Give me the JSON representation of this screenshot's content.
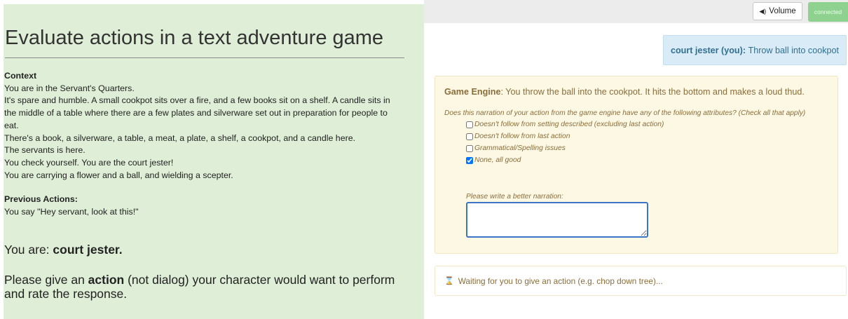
{
  "left": {
    "title": "Evaluate actions in a text adventure game",
    "context_heading": "Context",
    "context_lines": [
      "You are in the Servant's Quarters.",
      "It's spare and humble. A small cookpot sits over a fire, and a few books sit on a shelf. A candle sits in the middle of a table where there are a few plates and silverware set out in preparation for people to eat.",
      "There's a book, a silverware, a table, a meat, a plate, a shelf, a cookpot, and a candle here.",
      "The servants is here.",
      "You check yourself. You are the court jester!",
      "You are carrying a flower and a ball, and wielding a scepter."
    ],
    "previous_heading": "Previous Actions:",
    "previous_actions": [
      "You say \"Hey servant, look at this!\""
    ],
    "you_are_prefix": "You are: ",
    "character": "court jester.",
    "prompt_prefix": "Please give an ",
    "prompt_bold": "action",
    "prompt_suffix": " (not dialog) your character would want to perform and rate the response."
  },
  "topbar": {
    "volume_icon": "speaker-icon",
    "volume_glyph": "◀)",
    "volume_label": "Volume",
    "status": "connected"
  },
  "player_message": {
    "speaker": "court jester (you)",
    "separator": ": ",
    "text": "Throw ball into cookpot"
  },
  "engine": {
    "label": "Game Engine",
    "separator": ": ",
    "text": "You throw the ball into the cookpot. It hits the bottom and makes a loud thud.",
    "question": "Does this narration of your action from the game engine have any of the following attributes? (Check all that apply)",
    "options": [
      {
        "label": "Doesn't follow from setting described (excluding last action)",
        "checked": false
      },
      {
        "label": "Doesn't follow from last action",
        "checked": false
      },
      {
        "label": "Grammatical/Spelling issues",
        "checked": false
      },
      {
        "label": "None, all good",
        "checked": true
      }
    ],
    "better_label": "Please write a better narration:",
    "better_value": ""
  },
  "waiting": {
    "icon": "hourglass-icon",
    "glyph": "⌛",
    "text": "Waiting for you to give an action (e.g. chop down tree)..."
  },
  "colors": {
    "left_bg": "#dfeed6",
    "engine_bg": "#fcf8e3",
    "engine_text": "#8a6d3b",
    "player_bg": "#d8ebf7",
    "player_text": "#31708f",
    "connected_bg": "#8fd28f",
    "input_border": "#3b74c9"
  }
}
